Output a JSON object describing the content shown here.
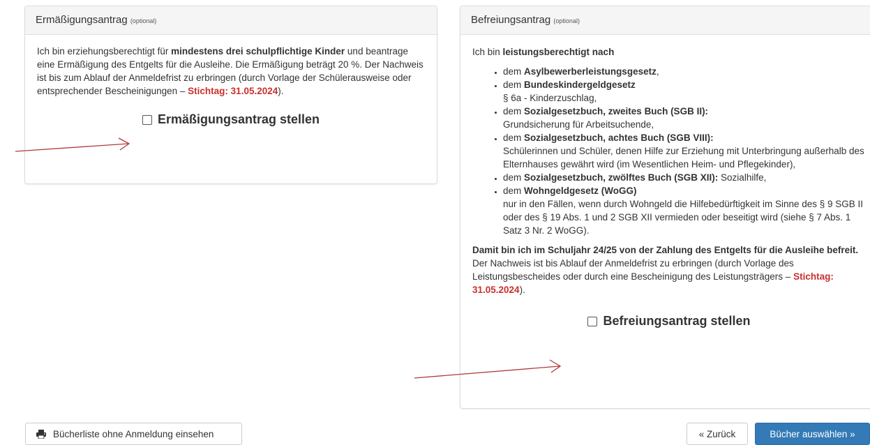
{
  "left_panel": {
    "title": "Ermäßigungsantrag",
    "title_note": "(optional)",
    "text_1": "Ich bin erziehungsberechtigt für ",
    "text_bold": "mindestens drei schulpflichtige Kinder",
    "text_2": " und beantrage eine Ermäßigung des Entgelts für die Ausleihe. Die Ermäßigung beträgt 20 %. Der Nachweis ist bis zum Ablauf der Anmeldefrist zu erbringen (durch Vorlage der Schülerausweise oder entsprechender Bescheinigungen – ",
    "deadline": "Stichtag: 31.05.2024",
    "text_3": ").",
    "checkbox_label": "Ermäßigungsantrag stellen"
  },
  "right_panel": {
    "title": "Befreiungsantrag",
    "title_note": "(optional)",
    "intro": "Ich bin ",
    "intro_bold": "leistungsberechtigt nach",
    "items": [
      {
        "prefix": "dem ",
        "bold": "Asylbewerberleistungsgesetz",
        "after": ",",
        "line2": ""
      },
      {
        "prefix": "dem ",
        "bold": "Bundeskindergeldgesetz",
        "after": "",
        "line2": "§ 6a - Kinderzuschlag,"
      },
      {
        "prefix": "dem ",
        "bold": "Sozialgesetzbuch, zweites Buch (SGB II):",
        "after": "",
        "line2": "Grundsicherung für Arbeitsuchende,"
      },
      {
        "prefix": "dem ",
        "bold": "Sozialgesetzbuch, achtes Buch (SGB VIII):",
        "after": "",
        "line2": "Schülerinnen und Schüler, denen Hilfe zur Erziehung mit Unterbringung außerhalb des Elternhauses gewährt wird (im Wesentlichen Heim- und Pflegekinder),"
      },
      {
        "prefix": "dem ",
        "bold": "Sozialgesetzbuch, zwölftes Buch (SGB XII):",
        "after": " Sozialhilfe,",
        "line2": ""
      },
      {
        "prefix": "dem ",
        "bold": "Wohngeldgesetz (WoGG)",
        "after": "",
        "line2": "nur in den Fällen, wenn durch Wohngeld die Hilfebedürftigkeit im Sinne des § 9 SGB II oder des § 19 Abs. 1 und 2 SGB XII vermieden oder beseitigt wird (siehe § 7 Abs. 1 Satz 3 Nr. 2 WoGG)."
      }
    ],
    "outro_bold": "Damit bin ich im Schuljahr 24/25 von der Zahlung des Entgelts für die Ausleihe befreit.",
    "outro": " Der Nachweis ist bis Ablauf der Anmeldefrist zu erbringen (durch Vorlage des Leistungsbescheides oder durch eine Bescheinigung des Leistungsträgers – ",
    "deadline": "Stichtag: 31.05.2024",
    "outro_end": ").",
    "checkbox_label": "Befreiungsantrag stellen"
  },
  "buttons": {
    "books_without_registration": "Bücherliste ohne Anmeldung einsehen",
    "back": "« Zurück",
    "next": "Bücher auswählen »"
  },
  "icons": {
    "printer": "printer-icon",
    "arrow": "red-arrow-annotation"
  },
  "colors": {
    "deadline": "#c9302c",
    "primary": "#337ab7",
    "arrow": "#b03a3a"
  }
}
